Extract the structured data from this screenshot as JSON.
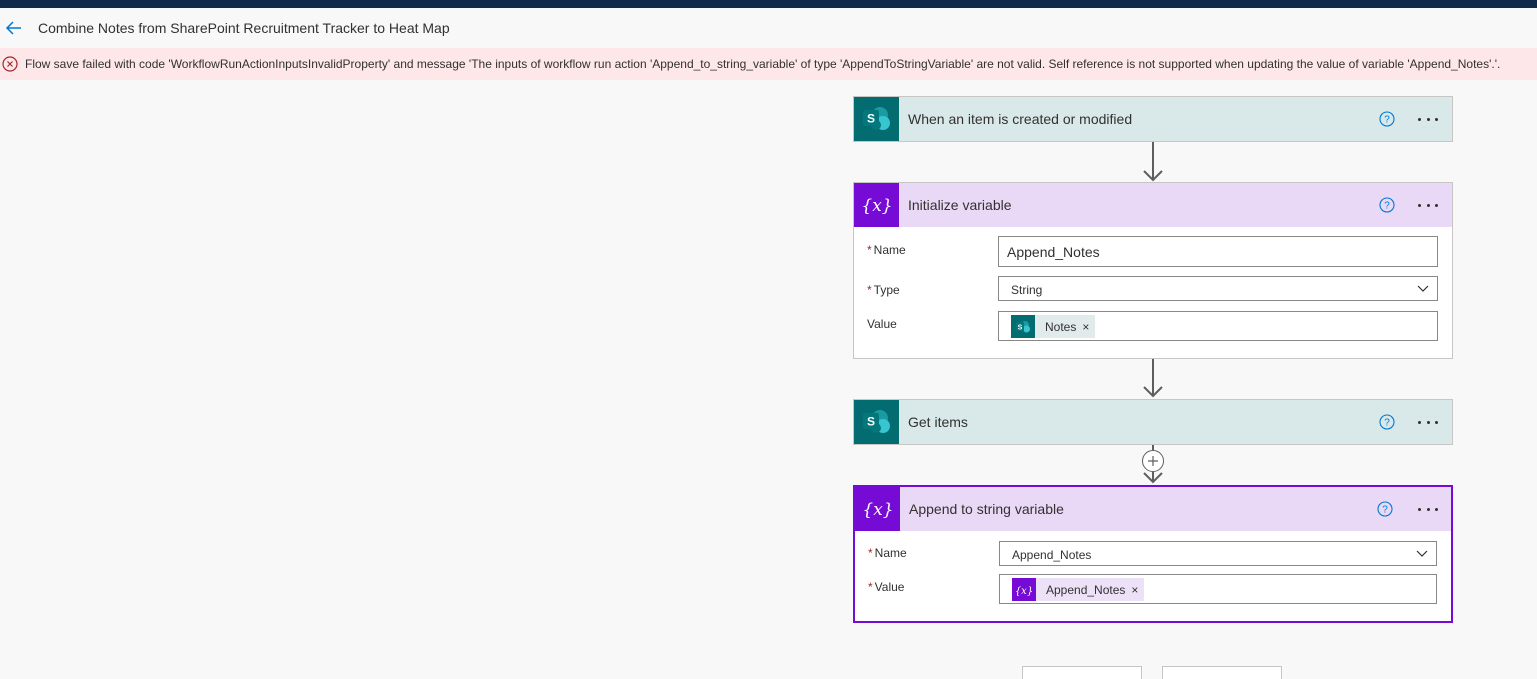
{
  "header": {
    "title": "Combine Notes from SharePoint Recruitment Tracker to Heat Map"
  },
  "error": {
    "message": "Flow save failed with code 'WorkflowRunActionInputsInvalidProperty' and message 'The inputs of workflow run action 'Append_to_string_variable' of type 'AppendToStringVariable' are not valid. Self reference is not supported when updating the value of variable 'Append_Notes'.'."
  },
  "cards": {
    "trigger": {
      "title": "When an item is created or modified",
      "icon": "sharepoint-icon"
    },
    "init_variable": {
      "title": "Initialize variable",
      "icon": "variable-icon",
      "name_label": "Name",
      "name_value": "Append_Notes",
      "type_label": "Type",
      "type_value": "String",
      "value_label": "Value",
      "value_token": "Notes",
      "required_mark": "*"
    },
    "get_items": {
      "title": "Get items",
      "icon": "sharepoint-icon"
    },
    "append": {
      "title": "Append to string variable",
      "icon": "variable-icon",
      "name_label": "Name",
      "name_value": "Append_Notes",
      "value_label": "Value",
      "value_token": "Append_Notes",
      "required_mark": "*"
    }
  },
  "glyphs": {
    "token_remove": "×"
  },
  "colors": {
    "sharepoint": "#036c70",
    "variable": "#770bd6",
    "error_bg": "#fde7e9",
    "error": "#a4262c",
    "accent": "#0078d4"
  }
}
